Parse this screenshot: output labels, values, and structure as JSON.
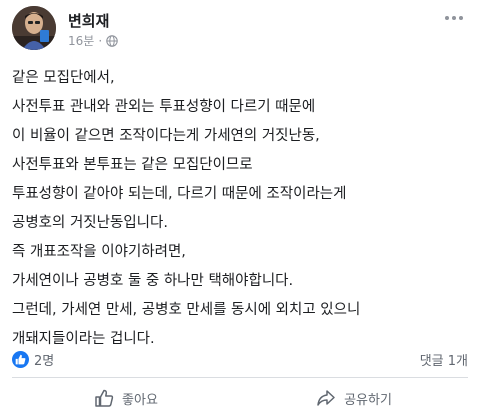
{
  "post": {
    "author": "변희재",
    "time": "16분",
    "privacy_icon": "globe-icon",
    "more_icon": "more-options-icon",
    "lines": [
      "같은 모집단에서,",
      "사전투표 관내와 관외는 투표성향이 다르기 때문에",
      "이 비율이 같으면 조작이다는게 가세연의 거짓난동,",
      "사전투표와 본투표는 같은 모집단이므로",
      "투표성향이 같아야 되는데, 다르기 때문에 조작이라는게",
      "공병호의 거짓난동입니다.",
      "즉 개표조작을 이야기하려면,",
      "가세연이나 공병호 둘 중 하나만 택해야합니다.",
      "그런데, 가세연 만세, 공병호 만세를 동시에 외치고 있으니",
      "개돼지들이라는 겁니다."
    ]
  },
  "stats": {
    "likes": "2명",
    "comments": "댓글 1개"
  },
  "actions": {
    "like_label": "좋아요",
    "share_label": "공유하기"
  },
  "colors": {
    "text": "#1c1e21",
    "meta": "#90949c",
    "accent": "#1877f2",
    "divider": "#dadde1"
  }
}
